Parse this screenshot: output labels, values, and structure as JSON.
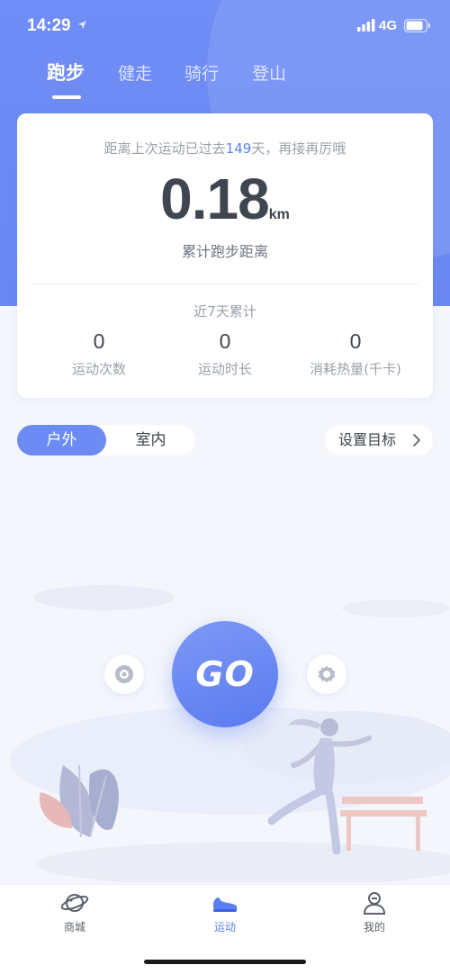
{
  "status_bar": {
    "time": "14:29",
    "network": "4G"
  },
  "sport_tabs": [
    {
      "label": "跑步",
      "active": true
    },
    {
      "label": "健走",
      "active": false
    },
    {
      "label": "骑行",
      "active": false
    },
    {
      "label": "登山",
      "active": false
    }
  ],
  "summary": {
    "prefix": "距离上次运动已过去",
    "days_since": "149",
    "suffix": "天，再接再厉哦",
    "distance_value": "0.18",
    "distance_unit": "km",
    "distance_caption": "累计跑步距离",
    "week_title": "近7天累计",
    "stats": [
      {
        "value": "0",
        "label": "运动次数"
      },
      {
        "value": "0",
        "label": "运动时长"
      },
      {
        "value": "0",
        "label": "消耗热量(千卡)"
      }
    ]
  },
  "environment": {
    "options": [
      "户外",
      "室内"
    ],
    "selected": "户外"
  },
  "goal_button": {
    "label": "设置目标"
  },
  "go_button": {
    "label": "GO"
  },
  "bottom_nav": [
    {
      "label": "商城",
      "icon": "planet-icon",
      "active": false
    },
    {
      "label": "运动",
      "icon": "shoe-icon",
      "active": true
    },
    {
      "label": "我的",
      "icon": "profile-icon",
      "active": false
    }
  ],
  "colors": {
    "accent": "#5b7ff2",
    "header": "#6f8df5",
    "background": "#f4f6fc"
  }
}
